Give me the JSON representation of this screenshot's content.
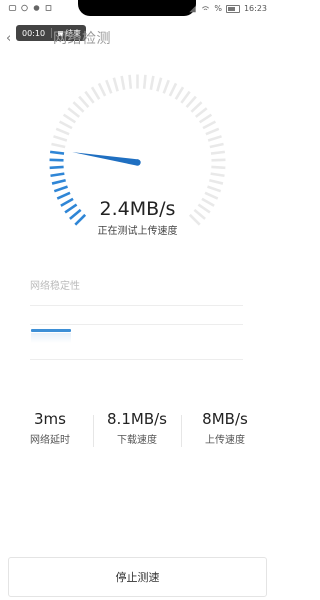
{
  "status_bar": {
    "right_percent": "%",
    "time": "16:23"
  },
  "recording": {
    "elapsed": "00:10",
    "stop_label": "结束"
  },
  "header": {
    "back_icon": "back-arrow-icon",
    "title": "网络检测"
  },
  "gauge": {
    "speed": "2.4MB/s",
    "status": "正在测试上传速度",
    "progress": 0.2,
    "accent_color": "#2f86d6",
    "track_color": "#e9e9e9"
  },
  "stability": {
    "label": "网络稳定性"
  },
  "stats": [
    {
      "value": "3ms",
      "label": "网络延时"
    },
    {
      "value": "8.1MB/s",
      "label": "下载速度"
    },
    {
      "value": "8MB/s",
      "label": "上传速度"
    }
  ],
  "actions": {
    "stop_label": "停止测速"
  }
}
